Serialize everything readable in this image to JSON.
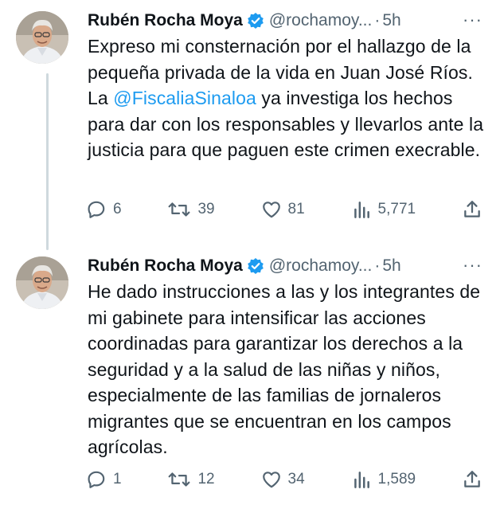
{
  "tweets": [
    {
      "author_name": "Rubén Rocha Moya",
      "handle": "@rochamoy...",
      "dot": "·",
      "time": "5h",
      "more": "···",
      "text_before": "Expreso mi consternación por el hallazgo de la pequeña privada de la vida en Juan José Ríos. La ",
      "mention": "@FiscaliaSinaloa",
      "text_after": " ya investiga los hechos para dar con los responsables y llevarlos ante la justicia para que paguen este crimen execrable.",
      "replies": "6",
      "retweets": "39",
      "likes": "81",
      "views": "5,771"
    },
    {
      "author_name": "Rubén Rocha Moya",
      "handle": "@rochamoy...",
      "dot": "·",
      "time": "5h",
      "more": "···",
      "text": "He dado instrucciones a las y los integrantes de mi gabinete para intensificar las acciones coordinadas para garantizar los derechos a la seguridad y a la salud de las niñas y niños, especialmente de las familias de jornaleros migrantes que se encuentran en los campos agrícolas.",
      "replies": "1",
      "retweets": "12",
      "likes": "34",
      "views": "1,589"
    }
  ],
  "colors": {
    "text": "#0f1419",
    "secondary": "#536471",
    "mention": "#1d9bf0",
    "verified": "#1d9bf0",
    "thread_line": "#cfd9de"
  },
  "icons": {
    "reply": "reply-icon",
    "retweet": "retweet-icon",
    "like": "heart-icon",
    "views": "views-icon",
    "share": "share-icon",
    "verified": "verified-badge-icon"
  }
}
